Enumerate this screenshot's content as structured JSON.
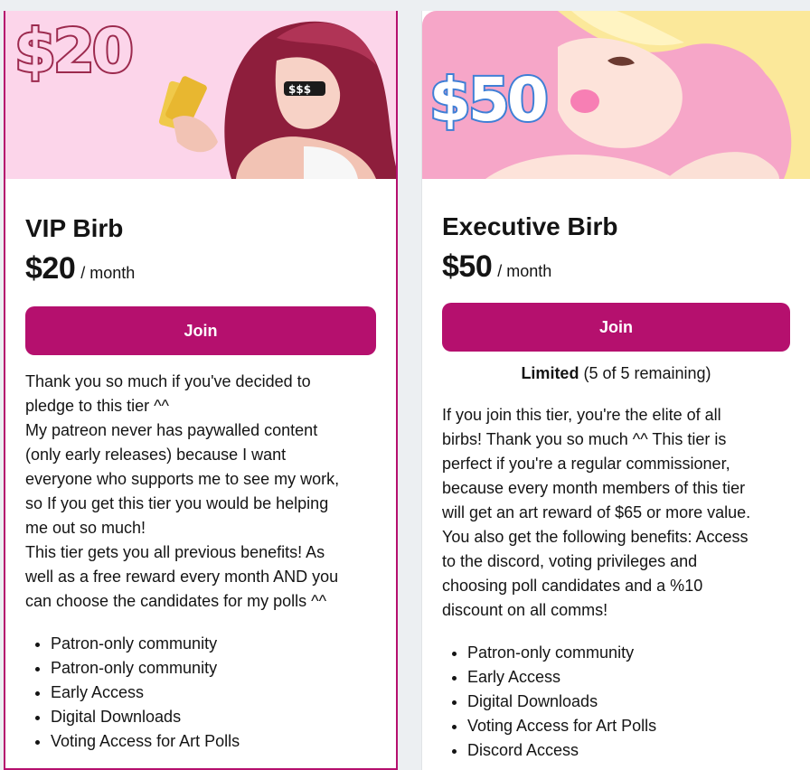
{
  "tiers": [
    {
      "badge": "$20",
      "title": "VIP Birb",
      "price": "$20",
      "period": "/ month",
      "join_label": "Join",
      "description": [
        "Thank you so much if you've decided to",
        "pledge to this tier ^^",
        "My patreon never has paywalled content",
        "(only early releases) because I want",
        "everyone who supports me to see my work,",
        "so If you get this tier you would be helping",
        "me out so much!",
        "This tier gets you all previous benefits! As",
        "well as a free reward every month AND you",
        "can choose the candidates for my polls ^^"
      ],
      "benefits": [
        "Patron-only community",
        "Patron-only community",
        "Early Access",
        "Digital Downloads",
        "Voting Access for Art Polls"
      ]
    },
    {
      "badge": "$50",
      "title": "Executive Birb",
      "price": "$50",
      "period": "/ month",
      "join_label": "Join",
      "limited_label": "Limited",
      "limited_detail": "(5 of 5 remaining)",
      "description": [
        "If you join this tier, you're the elite of all",
        "birbs! Thank you so much ^^ This tier is",
        "perfect if you're a regular commissioner,",
        "because every month members of this tier",
        "will get an art reward of $65 or more value.",
        "You also get the following benefits: Access",
        "to the discord, voting privileges and",
        "choosing poll candidates and a %10",
        "discount on all comms!"
      ],
      "benefits": [
        "Patron-only community",
        "Early Access",
        "Digital Downloads",
        "Voting Access for Art Polls",
        "Discord Access"
      ]
    }
  ],
  "colors": {
    "accent": "#b5106e",
    "banner_left_bg": "#fcd5ea",
    "banner_right_bg": "#f6a6c8"
  }
}
